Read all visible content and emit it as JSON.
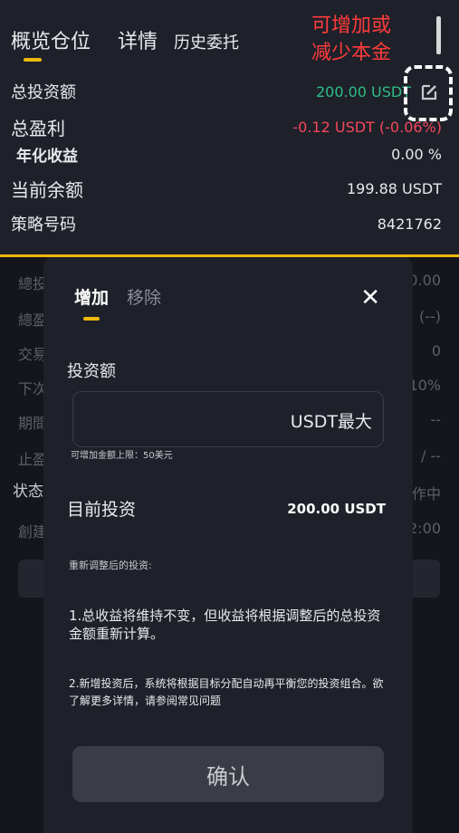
{
  "tabs": {
    "overview": "概览仓位",
    "details": "详情",
    "history": "历史委托"
  },
  "annotation": {
    "line1": "可增加或",
    "line2": "减少本金"
  },
  "summary": {
    "total_investment_label": "总投资额",
    "total_investment_value": "200.00 USDT",
    "total_profit_label": "总盈利",
    "total_profit_value": "-0.12 USDT (-0.06%)",
    "annualized_label": "年化收益",
    "annualized_value": "0.00 %",
    "balance_label": "当前余额",
    "balance_value": "199.88 USDT",
    "strategy_label": "策略号码",
    "strategy_value": "8421762"
  },
  "background": {
    "left_labels": [
      "總投",
      "總盈",
      "交易",
      "下次",
      "期間",
      "止盈"
    ],
    "right_values": [
      ".0.00",
      "(--)",
      "0",
      "10%",
      "--",
      "/ --"
    ],
    "status_label": "状态",
    "status_value": "作中",
    "created_label": "創建",
    "created_value": "2:00"
  },
  "modal": {
    "tab_add": "增加",
    "tab_remove": "移除",
    "close_symbol": "✕",
    "investment_label": "投资额",
    "input_suffix": "USDT最大",
    "input_value": "",
    "hint": "可增加金额上限：50美元",
    "current_investment_label": "目前投资",
    "current_investment_value": "200.00 USDT",
    "adjusted_label": "重新调整后的投资:",
    "note1": "1.总收益将维持不变，但收益将根据调整后的总投资金额重新计算。",
    "note2": "2.新增投资后，系统将根据目标分配自动再平衡您的投资组合。欲了解更多详情，请参阅常见问题",
    "confirm_label": "确认"
  },
  "colors": {
    "accent": "#f0b90b",
    "profit": "#2ebd85",
    "loss": "#f6465d",
    "annotation": "#ff3b3b"
  },
  "icons": {
    "edit": "edit-icon",
    "close": "close-icon"
  }
}
